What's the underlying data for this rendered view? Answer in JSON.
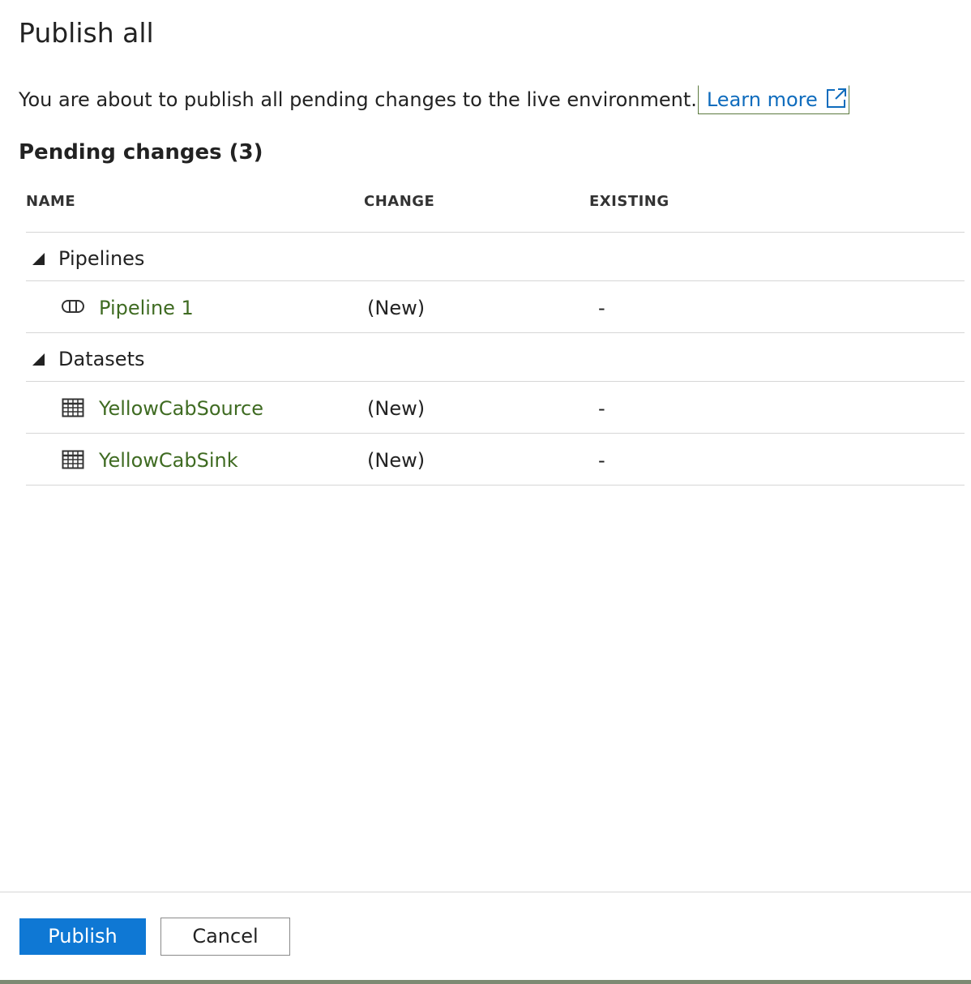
{
  "dialog": {
    "title": "Publish all",
    "intro_text": "You are about to publish all pending changes to the live environment.",
    "learn_more_label": "Learn more",
    "pending_title": "Pending changes (3)"
  },
  "table": {
    "columns": [
      "NAME",
      "CHANGE",
      "EXISTING"
    ],
    "groups": [
      {
        "label": "Pipelines",
        "items": [
          {
            "icon": "pipeline-icon",
            "name": "Pipeline 1",
            "change": "(New)",
            "existing": "-"
          }
        ]
      },
      {
        "label": "Datasets",
        "items": [
          {
            "icon": "dataset-table-icon",
            "name": "YellowCabSource",
            "change": "(New)",
            "existing": "-"
          },
          {
            "icon": "dataset-table-icon",
            "name": "YellowCabSink",
            "change": "(New)",
            "existing": "-"
          }
        ]
      }
    ]
  },
  "footer": {
    "publish_label": "Publish",
    "cancel_label": "Cancel"
  },
  "colors": {
    "accent": "#0f78d4",
    "link": "#0f6cbd",
    "item_name": "#3f6b22",
    "divider": "#d6d6d6"
  }
}
